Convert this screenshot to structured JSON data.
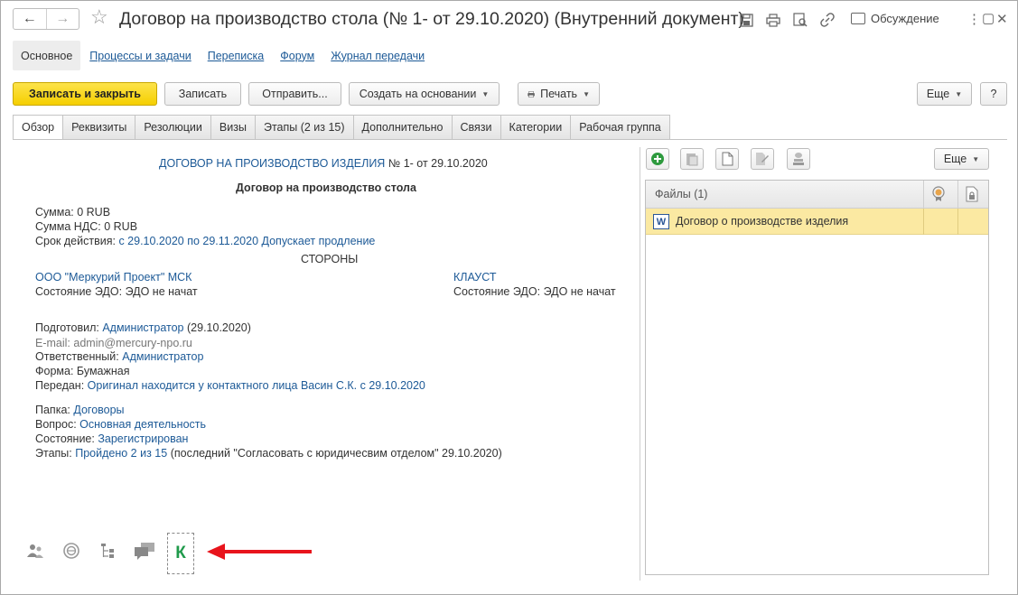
{
  "window": {
    "title": "Договор на производство стола (№ 1- от 29.10.2020) (Внутренний документ)",
    "discussion_label": "Обсуждение",
    "icons": [
      "back-arrow-icon",
      "forward-arrow-icon",
      "star-icon",
      "save-icon",
      "print-icon",
      "preview-icon",
      "link-icon",
      "green-k-icon",
      "more-vertical-icon",
      "maximize-icon",
      "close-icon"
    ]
  },
  "sections": [
    "Основное",
    "Процессы и задачи",
    "Переписка",
    "Форум",
    "Журнал передачи"
  ],
  "toolbar": {
    "save_close": "Записать и закрыть",
    "save": "Записать",
    "send": "Отправить...",
    "create_based": "Создать на основании",
    "print": "Печать",
    "more": "Еще",
    "help": "?"
  },
  "tabs": [
    "Обзор",
    "Реквизиты",
    "Резолюции",
    "Визы",
    "Этапы (2 из 15)",
    "Дополнительно",
    "Связи",
    "Категории",
    "Рабочая группа"
  ],
  "overview": {
    "header_link": "ДОГОВОР НА ПРОИЗВОДСТВО ИЗДЕЛИЯ",
    "header_suffix": " № 1- от 29.10.2020",
    "doc_title": "Договор на производство стола",
    "sum_label": "Сумма:",
    "sum_value": "0 RUB",
    "vat_label": "Сумма НДС:",
    "vat_value": "0 RUB",
    "term_label": "Срок действия:",
    "term_value": "с 29.10.2020 по 29.11.2020 Допускает продление",
    "parties_label": "СТОРОНЫ",
    "party1_name": "ООО \"Меркурий Проект\" МСК",
    "party1_edo_label": "Состояние ЭДО:",
    "party1_edo_value": "ЭДО не начат",
    "party2_name": "КЛАУСТ",
    "party2_edo_label": "Состояние ЭДО:",
    "party2_edo_value": "ЭДО не начат",
    "prepared_label": "Подготовил:",
    "prepared_value": "Администратор",
    "prepared_date": "(29.10.2020)",
    "email_label": "E-mail:",
    "email_value": "admin@mercury-npo.ru",
    "responsible_label": "Ответственный:",
    "responsible_value": "Администратор",
    "form_label": "Форма:",
    "form_value": "Бумажная",
    "transferred_label": "Передан:",
    "transferred_value": "Оригинал находится у контактного лица Васин С.К. с 29.10.2020",
    "folder_label": "Папка:",
    "folder_value": "Договоры",
    "question_label": "Вопрос:",
    "question_value": "Основная деятельность",
    "state_label": "Состояние:",
    "state_value": "Зарегистрирован",
    "stages_label": "Этапы:",
    "stages_value": "Пройдено 2 из 15",
    "stages_note": "(последний \"Согласовать с юридичесвим отделом\" 29.10.2020)"
  },
  "bottom_icons": [
    "users-icon",
    "stamp-icon",
    "tree-icon",
    "comments-icon"
  ],
  "k_label": "К",
  "files_panel": {
    "more": "Еще",
    "header": "Файлы (1)",
    "files": [
      {
        "icon": "W",
        "name": "Договор о производстве изделия"
      }
    ]
  },
  "colors": {
    "link": "#1d5a97",
    "primary_button": "#f5cf00",
    "selected_row": "#fbe9a2",
    "arrow": "#e8141c",
    "k_green": "#1f9a4b"
  }
}
